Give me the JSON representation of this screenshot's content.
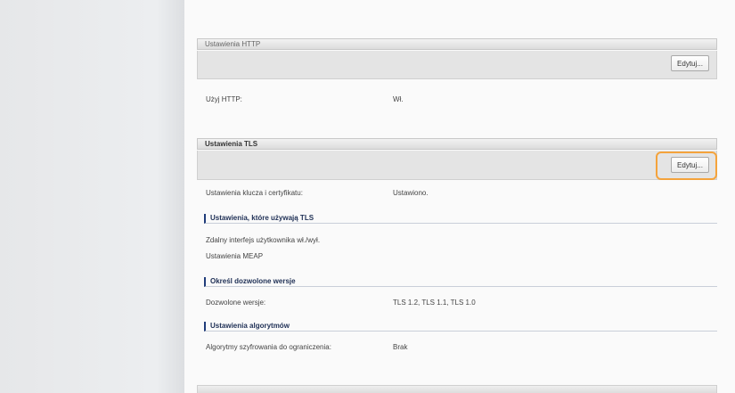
{
  "http_section": {
    "title": "Ustawienia HTTP",
    "edit_label": "Edytuj...",
    "rows": [
      {
        "label": "Użyj HTTP:",
        "value": "Wł."
      }
    ]
  },
  "tls_section": {
    "title": "Ustawienia TLS",
    "edit_label": "Edytuj...",
    "key_row": {
      "label": "Ustawienia klucza i certyfikatu:",
      "value": "Ustawiono."
    },
    "using_tls": {
      "heading": "Ustawienia, które używają TLS",
      "items": [
        "Zdalny interfejs użytkownika wł./wył.",
        "Ustawienia MEAP"
      ]
    },
    "versions": {
      "heading": "Określ dozwolone wersje",
      "label": "Dozwolone wersje:",
      "value": "TLS 1.2, TLS 1.1, TLS 1.0"
    },
    "algorithms": {
      "heading": "Ustawienia algorytmów",
      "label": "Algorytmy szyfrowania do ograniczenia:",
      "value": "Brak"
    }
  },
  "colors": {
    "highlight": "#f4a33c",
    "subhead_accent": "#1f3c7a"
  }
}
